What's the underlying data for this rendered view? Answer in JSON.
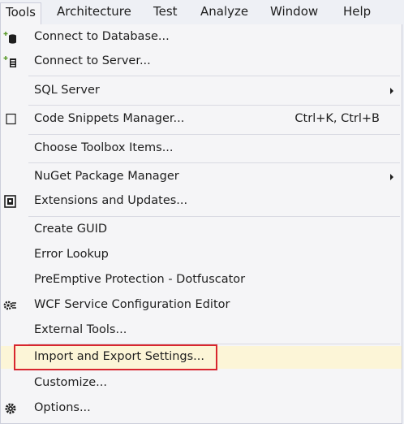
{
  "menubar": {
    "items": [
      {
        "label": "Tools"
      },
      {
        "label": "Architecture"
      },
      {
        "label": "Test"
      },
      {
        "label": "Analyze"
      },
      {
        "label": "Window"
      },
      {
        "label": "Help"
      }
    ]
  },
  "menu": {
    "items": [
      {
        "label": "Connect to Database...",
        "icon": "database-connect-icon"
      },
      {
        "label": "Connect to Server...",
        "icon": "server-connect-icon"
      },
      {
        "label": "SQL Server",
        "submenu": true
      },
      {
        "label": "Code Snippets Manager...",
        "shortcut": "Ctrl+K, Ctrl+B",
        "icon": "checkbox-icon"
      },
      {
        "label": "Choose Toolbox Items..."
      },
      {
        "label": "NuGet Package Manager",
        "submenu": true
      },
      {
        "label": "Extensions and Updates...",
        "icon": "extensions-icon"
      },
      {
        "label": "Create GUID"
      },
      {
        "label": "Error Lookup"
      },
      {
        "label": "PreEmptive Protection - Dotfuscator"
      },
      {
        "label": "WCF Service Configuration Editor",
        "icon": "wcf-config-icon"
      },
      {
        "label": "External Tools..."
      },
      {
        "label": "Import and Export Settings...",
        "highlighted": true
      },
      {
        "label": "Customize..."
      },
      {
        "label": "Options...",
        "icon": "gear-icon"
      }
    ]
  },
  "colors": {
    "menu_background": "#f5f5f7",
    "highlight_background": "#fcf5d7",
    "annotation_border": "#d8262e"
  }
}
